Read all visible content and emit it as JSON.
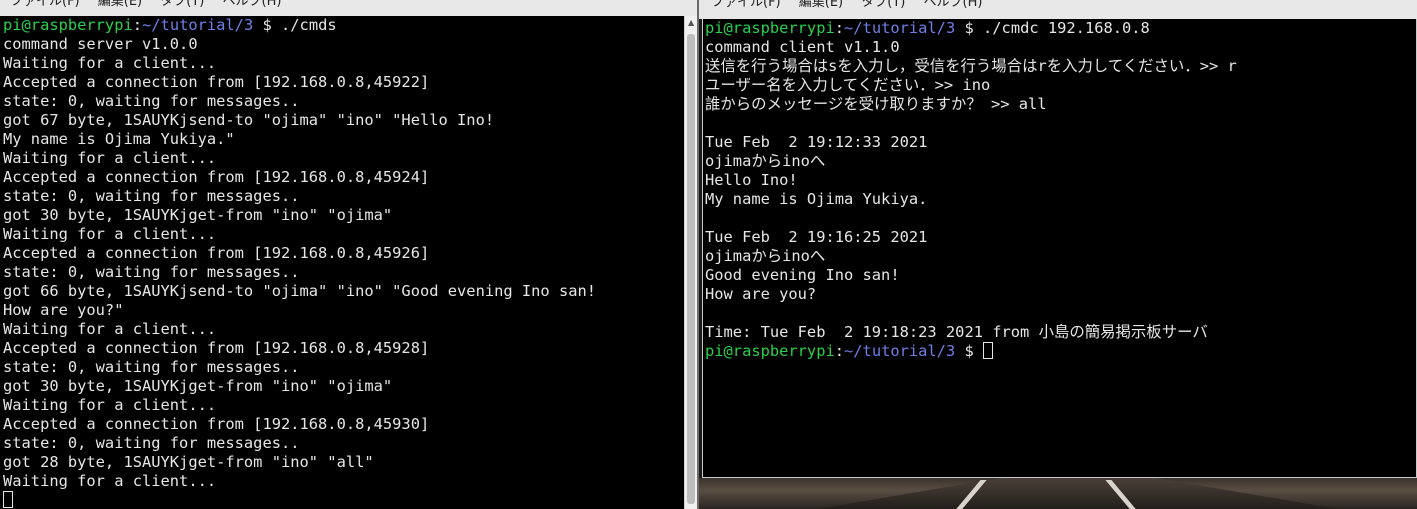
{
  "left_window": {
    "menu": [
      "ファイル(F)",
      "編集(E)",
      "タブ(T)",
      "ヘルプ(H)"
    ],
    "lines": [
      {
        "user": "pi@raspberrypi",
        "sep": ":",
        "path": "~/tutorial/3",
        "rest": " $ ./cmds"
      },
      {
        "text": "command server v1.0.0"
      },
      {
        "text": "Waiting for a client..."
      },
      {
        "text": "Accepted a connection from [192.168.0.8,45922]"
      },
      {
        "text": "state: 0, waiting for messages.."
      },
      {
        "text": "got 67 byte, 1SAUYKjsend-to \"ojima\" \"ino\" \"Hello Ino!"
      },
      {
        "text": "My name is Ojima Yukiya.\""
      },
      {
        "text": "Waiting for a client..."
      },
      {
        "text": "Accepted a connection from [192.168.0.8,45924]"
      },
      {
        "text": "state: 0, waiting for messages.."
      },
      {
        "text": "got 30 byte, 1SAUYKjget-from \"ino\" \"ojima\""
      },
      {
        "text": "Waiting for a client..."
      },
      {
        "text": "Accepted a connection from [192.168.0.8,45926]"
      },
      {
        "text": "state: 0, waiting for messages.."
      },
      {
        "text": "got 66 byte, 1SAUYKjsend-to \"ojima\" \"ino\" \"Good evening Ino san!"
      },
      {
        "text": "How are you?\""
      },
      {
        "text": "Waiting for a client..."
      },
      {
        "text": "Accepted a connection from [192.168.0.8,45928]"
      },
      {
        "text": "state: 0, waiting for messages.."
      },
      {
        "text": "got 30 byte, 1SAUYKjget-from \"ino\" \"ojima\""
      },
      {
        "text": "Waiting for a client..."
      },
      {
        "text": "Accepted a connection from [192.168.0.8,45930]"
      },
      {
        "text": "state: 0, waiting for messages.."
      },
      {
        "text": "got 28 byte, 1SAUYKjget-from \"ino\" \"all\""
      },
      {
        "text": "Waiting for a client..."
      }
    ]
  },
  "right_window": {
    "menu": [
      "ファイル(F)",
      "編集(E)",
      "タブ(T)",
      "ヘルプ(H)"
    ],
    "lines": [
      {
        "user": "pi@raspberrypi",
        "sep": ":",
        "path": "~/tutorial/3",
        "rest": " $ ./cmdc 192.168.0.8"
      },
      {
        "text": "command client v1.1.0"
      },
      {
        "text": "送信を行う場合はsを入力し，受信を行う場合はrを入力してください．>> r"
      },
      {
        "text": "ユーザー名を入力してください．>> ino"
      },
      {
        "text": "誰からのメッセージを受け取りますか？ >> all"
      },
      {
        "text": ""
      },
      {
        "text": "Tue Feb  2 19:12:33 2021"
      },
      {
        "text": "ojimaからinoへ"
      },
      {
        "text": "Hello Ino!"
      },
      {
        "text": "My name is Ojima Yukiya."
      },
      {
        "text": ""
      },
      {
        "text": "Tue Feb  2 19:16:25 2021"
      },
      {
        "text": "ojimaからinoへ"
      },
      {
        "text": "Good evening Ino san!"
      },
      {
        "text": "How are you?"
      },
      {
        "text": ""
      },
      {
        "text": "Time: Tue Feb  2 19:18:23 2021 from 小島の簡易掲示板サーバ"
      },
      {
        "user": "pi@raspberrypi",
        "sep": ":",
        "path": "~/tutorial/3",
        "rest": " $ "
      }
    ]
  },
  "colors": {
    "prompt_user": "#29d14b",
    "prompt_path": "#6f7fe8",
    "terminal_bg": "#000000",
    "terminal_fg": "#e6e6e6"
  }
}
